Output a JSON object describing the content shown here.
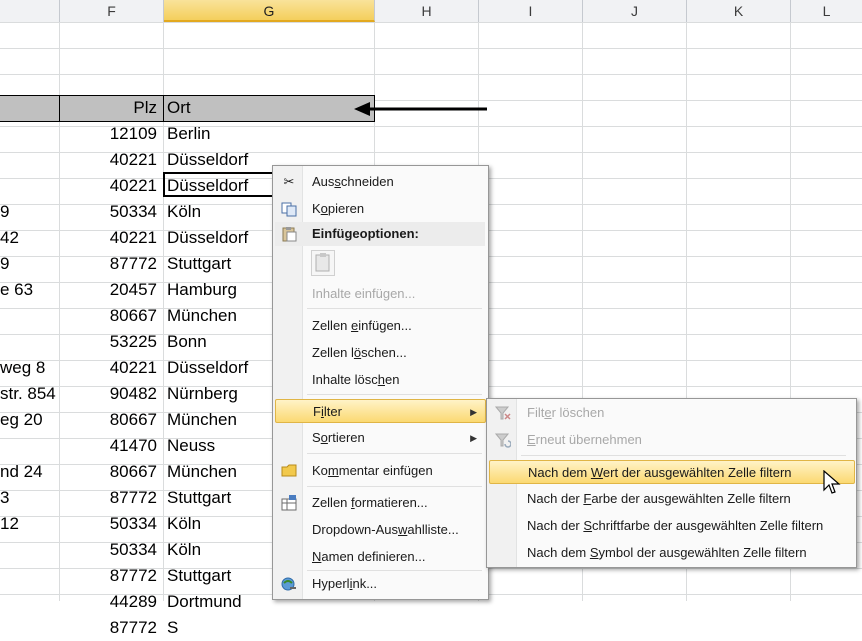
{
  "columns": [
    {
      "id": "F",
      "label": "F"
    },
    {
      "id": "G",
      "label": "G"
    },
    {
      "id": "H",
      "label": "H"
    },
    {
      "id": "I",
      "label": "I"
    },
    {
      "id": "J",
      "label": "J"
    },
    {
      "id": "K",
      "label": "K"
    },
    {
      "id": "L",
      "label": "L"
    }
  ],
  "header_row": {
    "plz": "Plz",
    "ort": "Ort"
  },
  "rows": [
    {
      "street": "",
      "plz": "12109",
      "ort": "Berlin"
    },
    {
      "street": "",
      "plz": "40221",
      "ort": "Düsseldorf"
    },
    {
      "street": "",
      "plz": "40221",
      "ort": "Düsseldorf"
    },
    {
      "street": "9",
      "plz": "50334",
      "ort": "Köln"
    },
    {
      "street": "42",
      "plz": "40221",
      "ort": "Düsseldorf"
    },
    {
      "street": "9",
      "plz": "87772",
      "ort": "Stuttgart"
    },
    {
      "street": "e 63",
      "plz": "20457",
      "ort": "Hamburg"
    },
    {
      "street": "",
      "plz": "80667",
      "ort": "München"
    },
    {
      "street": "",
      "plz": "53225",
      "ort": "Bonn"
    },
    {
      "street": "weg 8",
      "plz": "40221",
      "ort": "Düsseldorf"
    },
    {
      "street": "str. 854",
      "plz": "90482",
      "ort": "Nürnberg"
    },
    {
      "street": "eg 20",
      "plz": "80667",
      "ort": "München"
    },
    {
      "street": "",
      "plz": "41470",
      "ort": "Neuss"
    },
    {
      "street": "nd 24",
      "plz": "80667",
      "ort": "München"
    },
    {
      "street": "3",
      "plz": "87772",
      "ort": "Stuttgart"
    },
    {
      "street": "12",
      "plz": "50334",
      "ort": "Köln"
    },
    {
      "street": "",
      "plz": "50334",
      "ort": "Köln"
    },
    {
      "street": "",
      "plz": "87772",
      "ort": "Stuttgart"
    },
    {
      "street": "",
      "plz": "44289",
      "ort": "Dortmund"
    },
    {
      "street": "",
      "plz": "87772",
      "ort": "S"
    }
  ],
  "context_menu": {
    "cut": {
      "pre": "Aus",
      "u": "s",
      "post": "chneiden"
    },
    "copy": {
      "pre": "K",
      "u": "o",
      "post": "pieren"
    },
    "paste_options": "Einfügeoptionen:",
    "paste_special": {
      "pre": "Inhalte einfügen",
      "u": "",
      "post": "..."
    },
    "insert_cells": {
      "pre": "Zellen ",
      "u": "e",
      "post": "infügen..."
    },
    "delete_cells": {
      "pre": "Zellen l",
      "u": "ö",
      "post": "schen..."
    },
    "clear_contents": {
      "pre": "Inhalte lösc",
      "u": "h",
      "post": "en"
    },
    "filter": {
      "pre": "F",
      "u": "i",
      "post": "lter"
    },
    "sort": {
      "pre": "S",
      "u": "o",
      "post": "rtieren"
    },
    "comment": {
      "pre": "Ko",
      "u": "m",
      "post": "mentar einfügen"
    },
    "format_cells": {
      "pre": "Zellen ",
      "u": "f",
      "post": "ormatieren..."
    },
    "dropdown": {
      "pre": "Dropdown-Aus",
      "u": "w",
      "post": "ahlliste..."
    },
    "define_name": {
      "pre": "",
      "u": "N",
      "post": "amen definieren..."
    },
    "hyperlink": {
      "pre": "Hyperl",
      "u": "i",
      "post": "nk..."
    }
  },
  "filter_submenu": {
    "clear": {
      "pre": "Filt",
      "u": "e",
      "post": "r löschen"
    },
    "reapply": {
      "pre": "",
      "u": "E",
      "post": "rneut übernehmen"
    },
    "by_value": {
      "pre": "Nach dem ",
      "u": "W",
      "post": "ert der ausgewählten Zelle filtern"
    },
    "by_color": {
      "pre": "Nach der ",
      "u": "F",
      "post": "arbe der ausgewählten Zelle filtern"
    },
    "by_font_color": {
      "pre": "Nach der ",
      "u": "S",
      "post": "chriftfarbe der ausgewählten Zelle filtern"
    },
    "by_icon": {
      "pre": "Nach dem ",
      "u": "S",
      "post": "ymbol der ausgewählten Zelle filtern"
    }
  },
  "icons": {
    "cut": "scissors-icon",
    "copy": "copy-icon",
    "paste": "clipboard-icon",
    "comment": "comment-icon",
    "format": "format-cells-icon",
    "hyperlink": "hyperlink-icon",
    "clear_filter": "clear-filter-icon",
    "reapply": "reapply-filter-icon"
  },
  "colors": {
    "selected_header": "#f4cf5c",
    "header_band": "#c0c0c0",
    "menu_highlight": "#fbd972"
  }
}
